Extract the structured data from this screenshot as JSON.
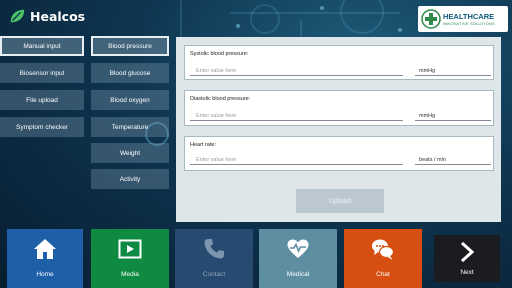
{
  "app": {
    "name": "Healcos"
  },
  "brand_logo": {
    "title": "HEALTHCARE",
    "subtitle": "INNOVATIVE SOLUTIONS"
  },
  "left_menu": [
    {
      "label": "Manual input",
      "active": true
    },
    {
      "label": "Biosensor input"
    },
    {
      "label": "File upload"
    },
    {
      "label": "Symptom checker"
    }
  ],
  "sub_menu": [
    {
      "label": "Blood pressure",
      "active": true
    },
    {
      "label": "Blood glucose"
    },
    {
      "label": "Blood oxygen"
    },
    {
      "label": "Temperature"
    },
    {
      "label": "Weight"
    },
    {
      "label": "Activity"
    }
  ],
  "form": {
    "fields": [
      {
        "label": "Systolic blood pressure:",
        "placeholder": "Enter value here",
        "unit": "mmHg"
      },
      {
        "label": "Diastolic blood pressure:",
        "placeholder": "Enter value here",
        "unit": "mmHg"
      },
      {
        "label": "Heart rate:",
        "placeholder": "Enter value here",
        "unit": "beats / min"
      }
    ],
    "upload_label": "Upload"
  },
  "bottom_nav": [
    {
      "label": "Home",
      "icon": "home-icon",
      "color": "#1e5fa8"
    },
    {
      "label": "Media",
      "icon": "play-icon",
      "color": "#0f8a43"
    },
    {
      "label": "Contact",
      "icon": "phone-icon",
      "color": "#274a70"
    },
    {
      "label": "Medical",
      "icon": "heart-pulse-icon",
      "color": "#5e8ea2"
    },
    {
      "label": "Chat",
      "icon": "chat-icon",
      "color": "#d64f10"
    },
    {
      "label": "Next",
      "icon": "chevron-right-icon",
      "color": "#1b1c20"
    }
  ],
  "colors": {
    "panel_bg": "#dfe6ea",
    "upload_disabled": "#bcc8cf",
    "background": "#0e3550"
  }
}
